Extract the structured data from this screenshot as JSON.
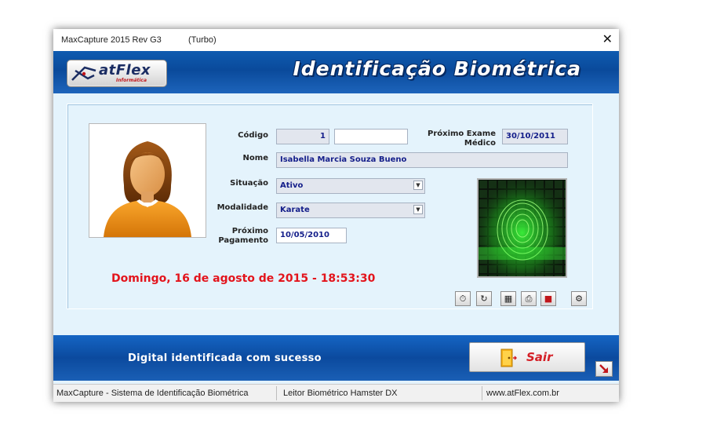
{
  "window": {
    "title": "MaxCapture 2015 Rev G3",
    "mode": "(Turbo)",
    "close_glyph": "✕"
  },
  "banner": {
    "logo_text": "atFlex",
    "logo_sub": "Informática",
    "title": "Identificação Biométrica"
  },
  "form": {
    "codigo_label": "Código",
    "codigo_value": "1",
    "codigo_extra_value": "",
    "proximo_exame_label_1": "Próximo Exame",
    "proximo_exame_label_2": "Médico",
    "proximo_exame_value": "30/10/2011",
    "nome_label": "Nome",
    "nome_value": "Isabella Marcia Souza Bueno",
    "situacao_label": "Situação",
    "situacao_value": "Ativo",
    "modalidade_label": "Modalidade",
    "modalidade_value": "Karate",
    "proximo_pagamento_label_1": "Próximo",
    "proximo_pagamento_label_2": "Pagamento",
    "proximo_pagamento_value": "10/05/2010"
  },
  "datetime": "Domingo, 16 de agosto de 2015 -  18:53:30",
  "toolbar_icons": [
    "timer-icon",
    "refresh-icon",
    "calculator-icon",
    "printer-icon",
    "power-off-icon",
    "settings-icon"
  ],
  "bottom": {
    "status_message": "Digital identificada com sucesso",
    "exit_label": "Sair"
  },
  "statusbar": {
    "system": "MaxCapture - Sistema de Identificação Biométrica",
    "reader": "Leitor Biométrico Hamster DX",
    "website": "www.atFlex.com.br"
  },
  "colors": {
    "banner_blue": "#0a4a9b",
    "field_text": "#141e8a",
    "datetime_red": "#e3141c",
    "exit_red": "#d41f26",
    "fingerprint_green": "#3cff3c"
  }
}
